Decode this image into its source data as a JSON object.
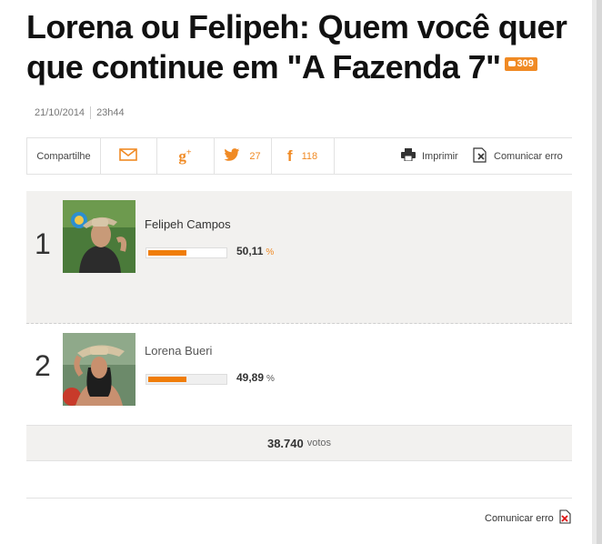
{
  "article": {
    "title": "Lorena ou Felipeh: Quem você quer que continue em \"A Fazenda 7\"",
    "comments_count": "309",
    "date": "21/10/2014",
    "time": "23h44"
  },
  "share": {
    "label": "Compartilhe",
    "twitter_count": "27",
    "facebook_count": "118",
    "print_label": "Imprimir",
    "report_label": "Comunicar erro"
  },
  "poll": {
    "items": [
      {
        "rank": "1",
        "name": "Felipeh Campos",
        "percent": "50,11",
        "share": 0.5011
      },
      {
        "rank": "2",
        "name": "Lorena Bueri",
        "percent": "49,89",
        "share": 0.4989
      }
    ],
    "percent_symbol": "%",
    "total_votes": "38.740",
    "votes_label": "votos"
  },
  "footer": {
    "report_label": "Comunicar erro"
  },
  "colors": {
    "accent": "#f08a24",
    "bar": "#f07d0a",
    "panel": "#f2f1ef"
  },
  "icons": [
    "comment-icon",
    "mail-icon",
    "google-plus-icon",
    "twitter-icon",
    "facebook-icon",
    "printer-icon",
    "report-error-icon"
  ]
}
